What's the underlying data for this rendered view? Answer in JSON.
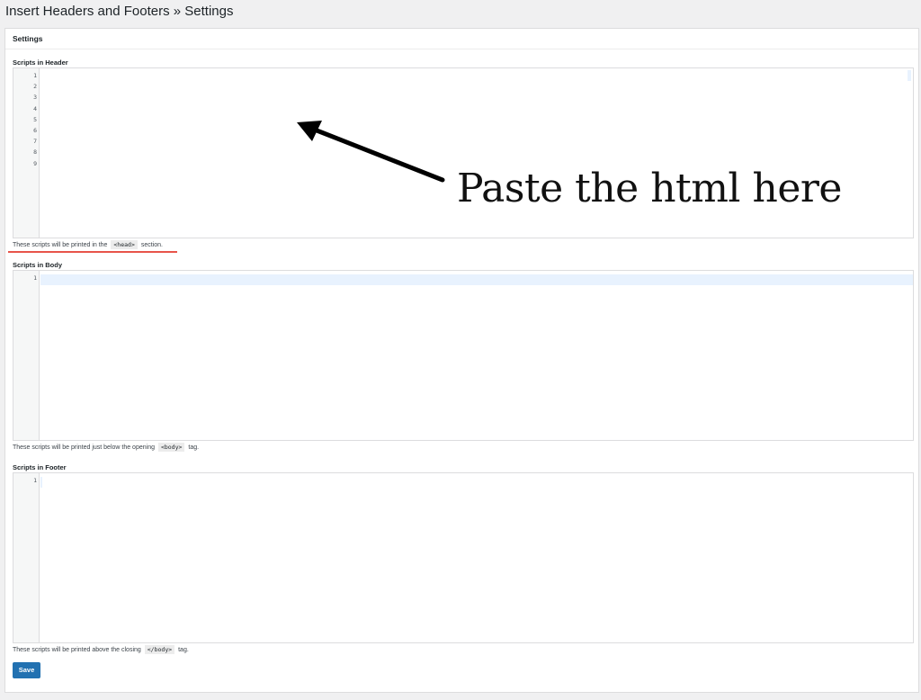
{
  "page": {
    "title": "Insert Headers and Footers » Settings"
  },
  "panel": {
    "heading": "Settings"
  },
  "header_section": {
    "label": "Scripts in Header",
    "line_numbers": [
      "1",
      "2",
      "3",
      "4",
      "5",
      "6",
      "7",
      "8",
      "9"
    ],
    "help_before": "These scripts will be printed in the",
    "help_code": "<head>",
    "help_after": "section."
  },
  "body_section": {
    "label": "Scripts in Body",
    "line_numbers": [
      "1"
    ],
    "help_before": "These scripts will be printed just below the opening",
    "help_code": "<body>",
    "help_after": "tag."
  },
  "footer_section": {
    "label": "Scripts in Footer",
    "line_numbers": [
      "1"
    ],
    "help_before": "These scripts will be printed above the closing",
    "help_code": "</body>",
    "help_after": "tag."
  },
  "actions": {
    "save_label": "Save"
  },
  "annotation": {
    "text": "Paste the html here",
    "underline_color": "#e8544a"
  },
  "colors": {
    "primary": "#2271b1",
    "active_line": "#e8f2fe"
  }
}
